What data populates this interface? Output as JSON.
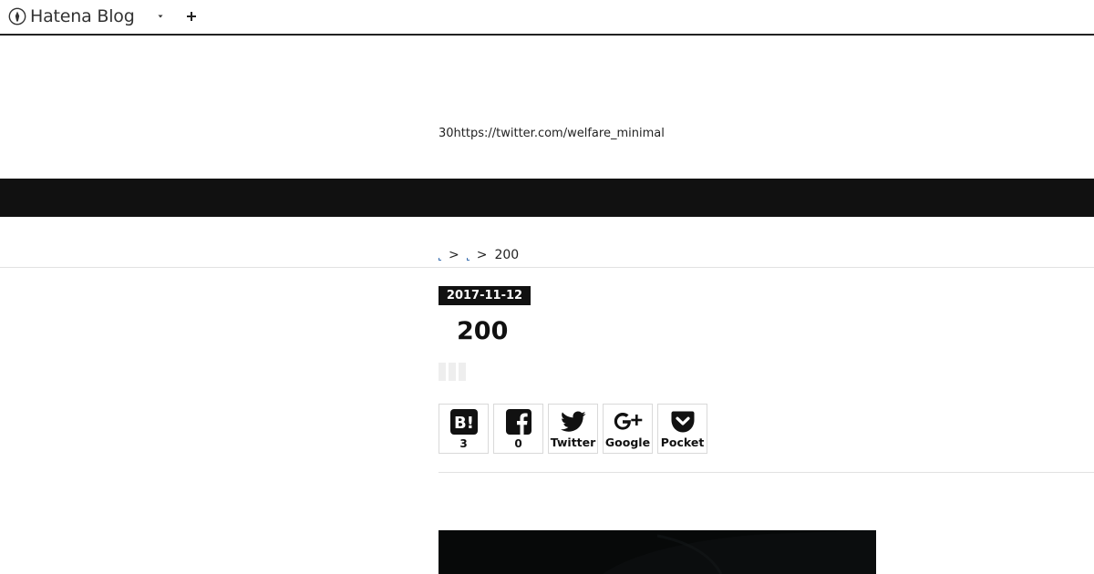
{
  "topbar": {
    "brand": "Hatena Blog"
  },
  "header": {
    "description": "30https://twitter.com/welfare_minimal"
  },
  "breadcrumb": {
    "separator": ">",
    "current": "200"
  },
  "article": {
    "date": "2017-11-12",
    "title": "200",
    "share": {
      "hatena": {
        "count": "3"
      },
      "facebook": {
        "count": "0"
      },
      "twitter": {
        "label": "Twitter"
      },
      "google": {
        "label": "Google"
      },
      "pocket": {
        "label": "Pocket"
      }
    }
  }
}
